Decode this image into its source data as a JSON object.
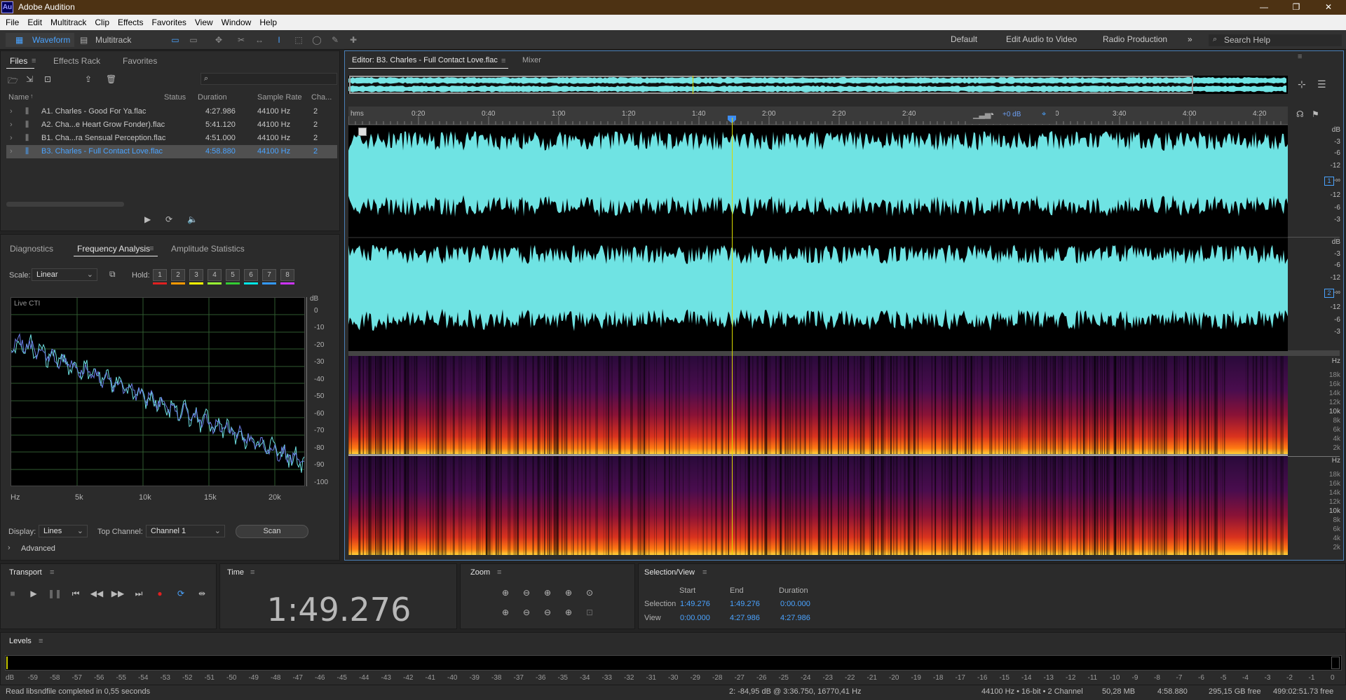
{
  "app": {
    "title": "Adobe Audition",
    "icon_text": "Au"
  },
  "menu": [
    "File",
    "Edit",
    "Multitrack",
    "Clip",
    "Effects",
    "Favorites",
    "View",
    "Window",
    "Help"
  ],
  "toolbar": {
    "waveform_label": "Waveform",
    "multitrack_label": "Multitrack"
  },
  "workspaces": [
    "Default",
    "Edit Audio to Video",
    "Radio Production"
  ],
  "search_help": "Search Help",
  "files_panel": {
    "tabs": [
      "Files",
      "Effects Rack",
      "Favorites"
    ],
    "columns": [
      "Name",
      "Status",
      "Duration",
      "Sample Rate",
      "Cha..."
    ],
    "rows": [
      {
        "name": "A1. Charles - Good For Ya.flac",
        "duration": "4:27.986",
        "rate": "44100 Hz",
        "ch": "2"
      },
      {
        "name": "A2. Cha...e Heart Grow Fonder).flac",
        "duration": "5:41.120",
        "rate": "44100 Hz",
        "ch": "2"
      },
      {
        "name": "B1. Cha...ra Sensual Perception.flac",
        "duration": "4:51.000",
        "rate": "44100 Hz",
        "ch": "2"
      },
      {
        "name": "B3. Charles - Full Contact Love.flac",
        "duration": "4:58.880",
        "rate": "44100 Hz",
        "ch": "2"
      }
    ],
    "selected_index": 3
  },
  "freq_panel": {
    "tabs": [
      "Diagnostics",
      "Frequency Analysis",
      "Amplitude Statistics"
    ],
    "scale_label": "Scale:",
    "scale_value": "Linear",
    "hold_label": "Hold:",
    "holds": [
      "1",
      "2",
      "3",
      "4",
      "5",
      "6",
      "7",
      "8"
    ],
    "hold_colors": [
      "#e02020",
      "#ff9900",
      "#ffff00",
      "#99ff33",
      "#33cc33",
      "#00e6e6",
      "#3399ff",
      "#cc33ff"
    ],
    "graph_label": "Live CTI",
    "db_unit": "dB",
    "db_ticks": [
      "0",
      "-10",
      "-20",
      "-30",
      "-40",
      "-50",
      "-60",
      "-70",
      "-80",
      "-90",
      "-100"
    ],
    "hz_ticks": [
      "Hz",
      "5k",
      "10k",
      "15k",
      "20k"
    ],
    "display_label": "Display:",
    "display_value": "Lines",
    "top_channel_label": "Top Channel:",
    "top_channel_value": "Channel 1",
    "scan_label": "Scan",
    "advanced_label": "Advanced"
  },
  "editor": {
    "tab_label": "Editor: B3. Charles - Full Contact Love.flac",
    "mixer_label": "Mixer",
    "ruler_ticks": [
      "hms",
      "0:20",
      "0:40",
      "1:00",
      "1:20",
      "1:40",
      "2:00",
      "2:20",
      "2:40",
      "0",
      "3:40",
      "4:00",
      "4:20"
    ],
    "hud_gain": "+0 dB",
    "db_scale": [
      "dB",
      "-3",
      "-6",
      "-12",
      "-∞",
      "-12",
      "-6",
      "-3"
    ],
    "channel_labels": [
      "1",
      "2"
    ],
    "hz_scale": [
      "Hz",
      "18k",
      "16k",
      "14k",
      "12k",
      "10k",
      "8k",
      "6k",
      "4k",
      "2k"
    ],
    "playhead_time_seconds": 109.276,
    "total_seconds": 298.88,
    "waveform_color": "#6fe3e3"
  },
  "transport": {
    "title": "Transport"
  },
  "time": {
    "title": "Time",
    "value": "1:49.276"
  },
  "zoom": {
    "title": "Zoom"
  },
  "selection_view": {
    "title": "Selection/View",
    "headers": [
      "Start",
      "End",
      "Duration"
    ],
    "selection_label": "Selection",
    "selection": [
      "1:49.276",
      "1:49.276",
      "0:00.000"
    ],
    "view_label": "View",
    "view": [
      "0:00.000",
      "4:27.986",
      "4:27.986"
    ]
  },
  "levels": {
    "title": "Levels",
    "ticks": [
      "dB",
      "-59",
      "-58",
      "-57",
      "-56",
      "-55",
      "-54",
      "-53",
      "-52",
      "-51",
      "-50",
      "-49",
      "-48",
      "-47",
      "-46",
      "-45",
      "-44",
      "-43",
      "-42",
      "-41",
      "-40",
      "-39",
      "-38",
      "-37",
      "-36",
      "-35",
      "-34",
      "-33",
      "-32",
      "-31",
      "-30",
      "-29",
      "-28",
      "-27",
      "-26",
      "-25",
      "-24",
      "-23",
      "-22",
      "-21",
      "-20",
      "-19",
      "-18",
      "-17",
      "-16",
      "-15",
      "-14",
      "-13",
      "-12",
      "-11",
      "-10",
      "-9",
      "-8",
      "-7",
      "-6",
      "-5",
      "-4",
      "-3",
      "-2",
      "-1",
      "0"
    ]
  },
  "status": {
    "left": "Read libsndfile completed in 0,55 seconds",
    "cursor": "2: -84,95 dB @ 3:36.750, 16770,41 Hz",
    "format": "44100 Hz • 16-bit • 2 Channel",
    "size": "50,28 MB",
    "duration": "4:58.880",
    "free": "295,15 GB free",
    "free_time": "499:02:51.73 free"
  }
}
